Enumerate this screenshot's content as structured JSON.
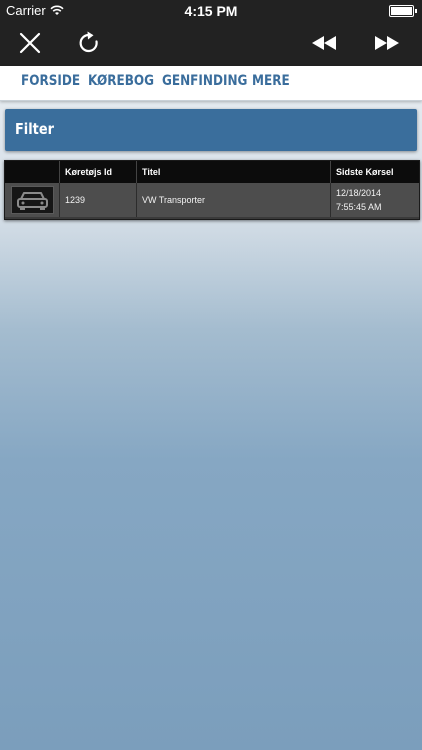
{
  "status_bar": {
    "carrier": "Carrier",
    "time": "4:15 PM"
  },
  "toolbar": {
    "close_icon": "close-icon",
    "refresh_icon": "refresh-icon",
    "rewind_icon": "rewind-icon",
    "fast_forward_icon": "fast-forward-icon"
  },
  "nav": {
    "items": [
      {
        "label": "FORSIDE"
      },
      {
        "label": "KØREBOG"
      },
      {
        "label": "GENFINDING"
      },
      {
        "label": "MERE"
      }
    ]
  },
  "filter": {
    "label": "Filter"
  },
  "table": {
    "columns": [
      "",
      "Køretøjs Id",
      "Titel",
      "Sidste Kørsel"
    ],
    "rows": [
      {
        "icon": "car-icon",
        "vehicle_id": "1239",
        "title": "VW Transporter",
        "last_drive_date": "12/18/2014",
        "last_drive_time": "7:55:45 AM"
      }
    ]
  },
  "colors": {
    "toolbar_bg": "#222222",
    "nav_text": "#3a6d9c",
    "filter_bg": "#3a6e9c",
    "table_header_bg": "#0c0c0c",
    "table_row_bg": "#4d4d4d"
  }
}
